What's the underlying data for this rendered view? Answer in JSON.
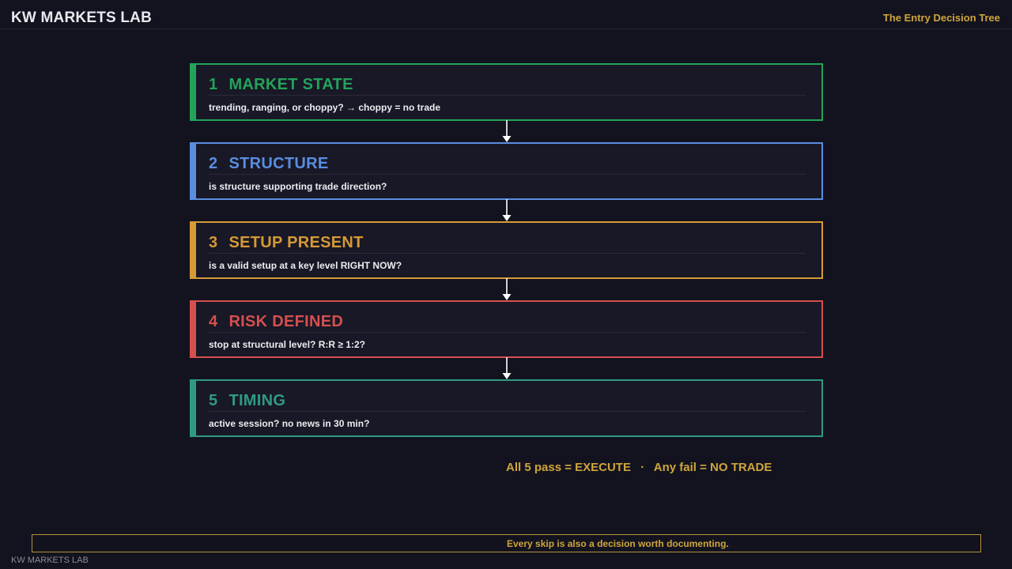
{
  "header": {
    "brand": "KW MARKETS LAB",
    "subtitle": "The Entry Decision Tree"
  },
  "steps": [
    {
      "number": "1",
      "title": "MARKET STATE",
      "question": "trending, ranging, or choppy? → choppy = no trade",
      "color": "#23a35a"
    },
    {
      "number": "2",
      "title": "STRUCTURE",
      "question": "is structure supporting trade direction?",
      "color": "#5a8de0"
    },
    {
      "number": "3",
      "title": "SETUP PRESENT",
      "question": "is a valid setup at a key level RIGHT NOW?",
      "color": "#d69a35"
    },
    {
      "number": "4",
      "title": "RISK DEFINED",
      "question": "stop at structural level? R:R ≥ 1:2?",
      "color": "#d64f4f"
    },
    {
      "number": "5",
      "title": "TIMING",
      "question": "active session? no news in 30 min?",
      "color": "#2f9a82"
    }
  ],
  "verdict": {
    "pass": "All 5 pass = EXECUTE",
    "separator": "·",
    "fail": "Any fail = NO TRADE"
  },
  "footer": {
    "note": "Every skip is also a decision worth documenting.",
    "brand": "KW MARKETS LAB"
  }
}
